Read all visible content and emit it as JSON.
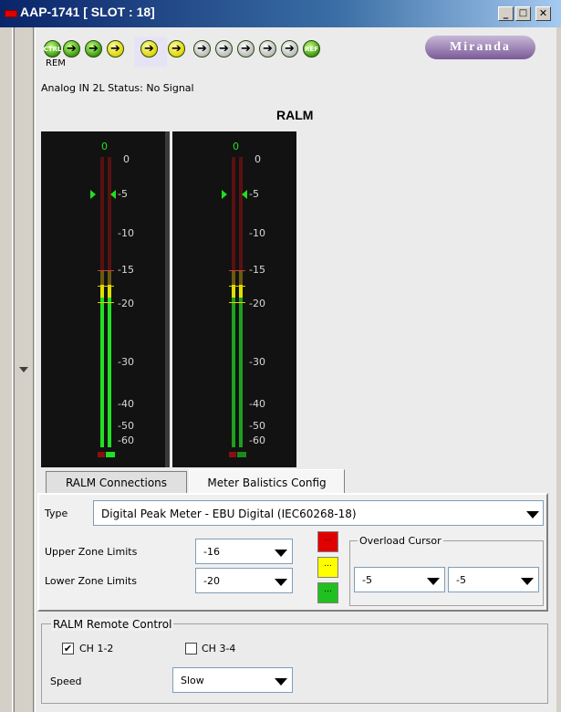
{
  "window": {
    "title": "AAP-1741 [ SLOT : 18]",
    "minimize_glyph": "_",
    "maximize_glyph": "□",
    "close_glyph": "✕"
  },
  "status_icons": {
    "ctrl_label": "CTRL",
    "ref_label": "REF",
    "rem_label": "REM"
  },
  "logo": {
    "text": "Miranda"
  },
  "status_text": "Analog IN 2L Status: No Signal",
  "ralm": {
    "title": "RALM",
    "meter_scale": [
      "0",
      "-5",
      "-10",
      "-15",
      "-20",
      "-30",
      "-40",
      "-50",
      "-60"
    ],
    "peak_label": "0",
    "meters": [
      {
        "id": "left",
        "peak_db": -19
      },
      {
        "id": "right",
        "peak_db": -19
      }
    ]
  },
  "tabs": [
    {
      "label": "RALM Connections",
      "active": false
    },
    {
      "label": "Meter Balistics Config",
      "active": true
    }
  ],
  "config": {
    "type_label": "Type",
    "type_value": "Digital Peak Meter - EBU Digital (IEC60268-18)",
    "upper_label": "Upper Zone Limits",
    "upper_value": "-16",
    "lower_label": "Lower Zone Limits",
    "lower_value": "-20",
    "swatch_text": "...",
    "zone_colors": {
      "red": "#e00000",
      "yellow": "#ffff00",
      "green": "#20c020"
    },
    "overload_title": "Overload Cursor",
    "overload_value_1": "-5",
    "overload_value_2": "-5"
  },
  "remote": {
    "title": "RALM Remote Control",
    "ch12_label": "CH 1-2",
    "ch12_checked": true,
    "ch12_mark": "✔",
    "ch34_label": "CH 3-4",
    "ch34_checked": false,
    "speed_label": "Speed",
    "speed_value": "Slow"
  }
}
